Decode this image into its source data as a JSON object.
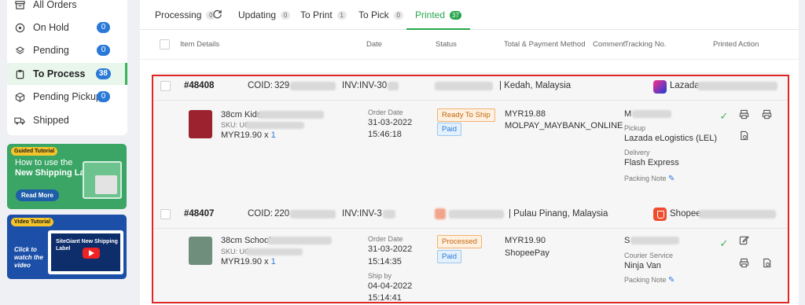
{
  "sidebar": {
    "items": [
      {
        "label": "All Orders",
        "badge": null,
        "icon": "archive-icon"
      },
      {
        "label": "On Hold",
        "badge": "0",
        "icon": "pause-icon"
      },
      {
        "label": "Pending",
        "badge": "0",
        "icon": "layers-icon"
      },
      {
        "label": "To Process",
        "badge": "38",
        "icon": "clipboard-icon"
      },
      {
        "label": "Pending Pickup",
        "badge": "0",
        "icon": "box-icon"
      },
      {
        "label": "Shipped",
        "badge": null,
        "icon": "truck-icon"
      }
    ],
    "banner1": {
      "tag": "Guided Tutorial",
      "line1": "How to use the",
      "line2": "New Shipping Label?",
      "button": "Read More"
    },
    "banner2": {
      "tag": "Video Tutorial",
      "text": "Click to watch the video",
      "screen_title": "SiteGiant New Shipping Label"
    }
  },
  "tabs": [
    {
      "label": "Processing",
      "count": "0"
    },
    {
      "label": "Updating",
      "count": "0"
    },
    {
      "label": "To Print",
      "count": "1"
    },
    {
      "label": "To Pick",
      "count": "0"
    },
    {
      "label": "Printed",
      "count": "37"
    }
  ],
  "columns": [
    "Item Details",
    "Date",
    "Status",
    "Total & Payment Method",
    "Comment",
    "Tracking No.",
    "Printed",
    "Action"
  ],
  "orders": [
    {
      "id": "#48408",
      "coid_label": "COID:",
      "coid": "329",
      "inv_label": "INV:",
      "inv": "INV-30",
      "location": "| Kedah, Malaysia",
      "channel": "Lazada",
      "item_name": "38cm Kids",
      "sku": "SKU: UO",
      "price": "MYR19.90 x",
      "qty": "1",
      "order_date_label": "Order Date",
      "order_date": "31-03-2022",
      "order_time": "15:46:18",
      "status": "Ready To Ship",
      "payment_status": "Paid",
      "total": "MYR19.88",
      "payment_method": "MOLPAY_MAYBANK_ONLINE",
      "tracking": "M",
      "pickup_label": "Pickup",
      "pickup": "Lazada eLogistics (LEL)",
      "delivery_label": "Delivery",
      "delivery": "Flash Express",
      "packing_note": "Packing Note"
    },
    {
      "id": "#48407",
      "coid_label": "COID:",
      "coid": "220",
      "inv_label": "INV:",
      "inv": "INV-3",
      "location": "| Pulau Pinang, Malaysia",
      "channel": "Shopee",
      "item_name": "38cm School",
      "sku": "SKU: UO",
      "price": "MYR19.90 x",
      "qty": "1",
      "order_date_label": "Order Date",
      "order_date": "31-03-2022",
      "order_time": "15:14:35",
      "ship_by_label": "Ship by",
      "ship_by_date": "04-04-2022",
      "ship_by_time": "15:14:41",
      "status": "Processed",
      "payment_status": "Paid",
      "total": "MYR19.90",
      "payment_method": "ShopeePay",
      "tracking": "S",
      "courier_label": "Courier Service",
      "courier": "Ninja Van",
      "packing_note": "Packing Note"
    }
  ]
}
